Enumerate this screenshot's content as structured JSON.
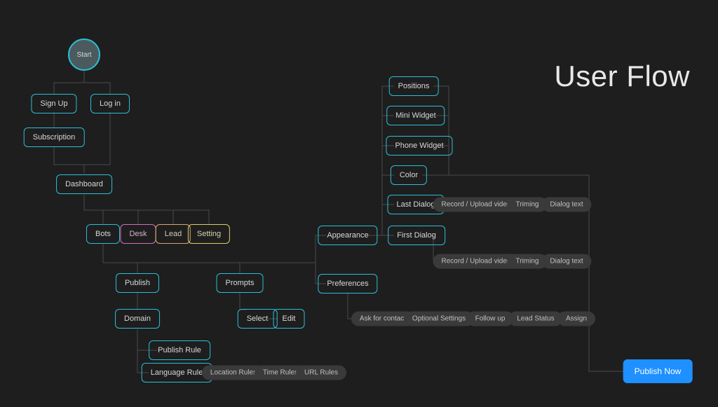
{
  "title": "User Flow",
  "nodes": {
    "start": "Start",
    "signup": "Sign Up",
    "login": "Log in",
    "subscription": "Subscription",
    "dashboard": "Dashboard",
    "bots": "Bots",
    "desk": "Desk",
    "lead": "Lead",
    "setting": "Setting",
    "publish": "Publish",
    "prompts": "Prompts",
    "domain": "Domain",
    "select": "Select",
    "edit": "Edit",
    "publish_rule": "Publish Rule",
    "language_rule": "Language Rule",
    "appearance": "Appearance",
    "preferences": "Preferences",
    "positions": "Positions",
    "mini_widget": "Mini Widget",
    "phone_widget": "Phone Widget",
    "color": "Color",
    "last_dialog": "Last Dialog",
    "first_dialog": "First Dialog"
  },
  "pills": {
    "record_upload1": "Record / Upload video",
    "triming1": "Triming",
    "dialog_text1": "Dialog text",
    "record_upload2": "Record / Upload video",
    "triming2": "Triming",
    "dialog_text2": "Dialog text",
    "ask_contact": "Ask for contact",
    "optional_settings": "Optional Settings",
    "follow_up": "Follow up",
    "lead_status": "Lead Status",
    "assign": "Assign",
    "location_rules": "Location Rules",
    "time_rules": "Time Rules",
    "url_rules": "URL Rules"
  },
  "button": {
    "publish_now": "Publish Now"
  }
}
